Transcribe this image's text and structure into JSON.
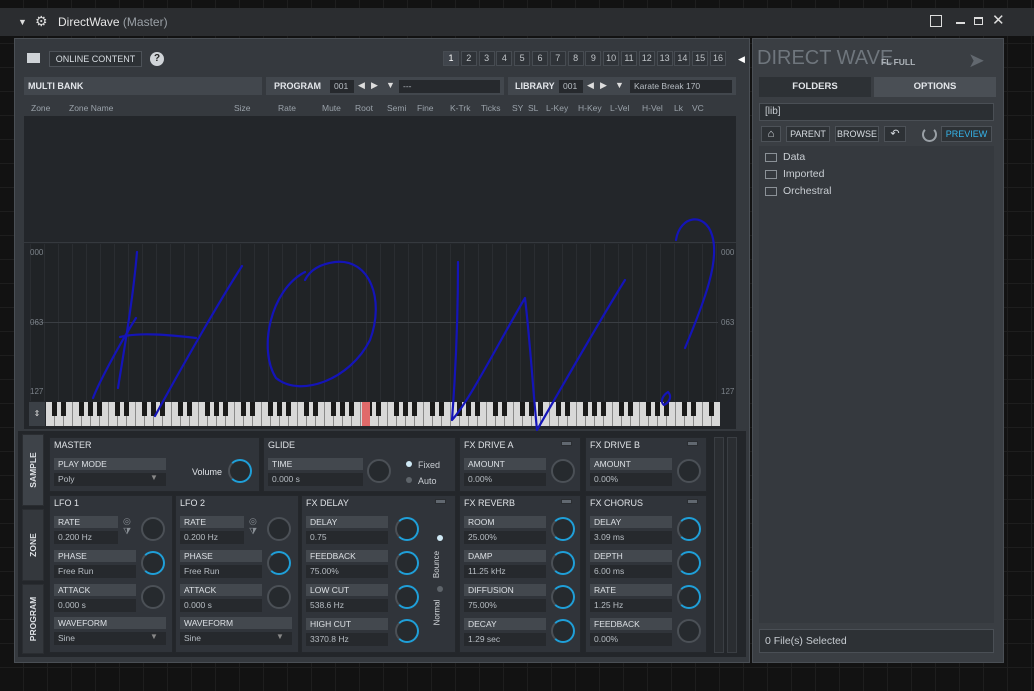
{
  "window": {
    "title": "DirectWave",
    "subtitle": "(Master)"
  },
  "toolbar": {
    "online_content": "ONLINE CONTENT",
    "help": "?",
    "page_tabs": [
      "1",
      "2",
      "3",
      "4",
      "5",
      "6",
      "7",
      "8",
      "9",
      "10",
      "11",
      "12",
      "13",
      "14",
      "15",
      "16"
    ],
    "active_tab": "1"
  },
  "bank": {
    "label": "MULTI BANK",
    "program_label": "PROGRAM",
    "program_num": "001",
    "program_name": "---",
    "library_label": "LIBRARY",
    "library_num": "001",
    "library_name": "Karate Break 170"
  },
  "columns": [
    "Zone",
    "Zone Name",
    "Size",
    "Rate",
    "Mute",
    "Root",
    "Semi",
    "Fine",
    "K-Trk",
    "Ticks",
    "SY",
    "SL",
    "L-Key",
    "H-Key",
    "L-Vel",
    "H-Vel",
    "Lk",
    "VC"
  ],
  "velocity_labels": [
    "000",
    "063",
    "127"
  ],
  "side_tabs": [
    "SAMPLE",
    "ZONE",
    "PROGRAM"
  ],
  "master": {
    "title": "MASTER",
    "play_mode_label": "PLAY MODE",
    "play_mode": "Poly",
    "volume_label": "Volume"
  },
  "glide": {
    "title": "GLIDE",
    "time_label": "TIME",
    "time": "0.000 s",
    "fixed": "Fixed",
    "auto": "Auto"
  },
  "fx_drive_a": {
    "title": "FX DRIVE A",
    "amount_label": "AMOUNT",
    "amount": "0.00%"
  },
  "fx_drive_b": {
    "title": "FX DRIVE B",
    "amount_label": "AMOUNT",
    "amount": "0.00%"
  },
  "lfo1": {
    "title": "LFO 1",
    "rate_label": "RATE",
    "rate": "0.200 Hz",
    "phase_label": "PHASE",
    "phase": "Free Run",
    "attack_label": "ATTACK",
    "attack": "0.000 s",
    "waveform_label": "WAVEFORM",
    "waveform": "Sine"
  },
  "lfo2": {
    "title": "LFO 2",
    "rate_label": "RATE",
    "rate": "0.200 Hz",
    "phase_label": "PHASE",
    "phase": "Free Run",
    "attack_label": "ATTACK",
    "attack": "0.000 s",
    "waveform_label": "WAVEFORM",
    "waveform": "Sine"
  },
  "fx_delay": {
    "title": "FX DELAY",
    "delay_label": "DELAY",
    "delay": "0.75",
    "feedback_label": "FEEDBACK",
    "feedback": "75.00%",
    "lowcut_label": "LOW CUT",
    "lowcut": "538.6 Hz",
    "highcut_label": "HIGH CUT",
    "highcut": "3370.8 Hz",
    "bounce": "Bounce",
    "normal": "Normal"
  },
  "fx_reverb": {
    "title": "FX REVERB",
    "room_label": "ROOM",
    "room": "25.00%",
    "damp_label": "DAMP",
    "damp": "11.25 kHz",
    "diffusion_label": "DIFFUSION",
    "diffusion": "75.00%",
    "decay_label": "DECAY",
    "decay": "1.29 sec"
  },
  "fx_chorus": {
    "title": "FX CHORUS",
    "delay_label": "DELAY",
    "delay": "3.09 ms",
    "depth_label": "DEPTH",
    "depth": "6.00 ms",
    "rate_label": "RATE",
    "rate": "1.25 Hz",
    "feedback_label": "FEEDBACK",
    "feedback": "0.00%"
  },
  "browser": {
    "logo": "DIRECT WAVE",
    "edition": "FL FULL",
    "tab_folders": "FOLDERS",
    "tab_options": "OPTIONS",
    "path": "[lib]",
    "parent": "PARENT",
    "browse": "BROWSE",
    "preview": "PREVIEW",
    "folders": [
      "Data",
      "Imported",
      "Orchestral"
    ],
    "status": "0 File(s) Selected"
  },
  "colors": {
    "accent": "#1f9fd8",
    "scribble": "#1414b8",
    "key_highlight": "#e06a6a"
  }
}
